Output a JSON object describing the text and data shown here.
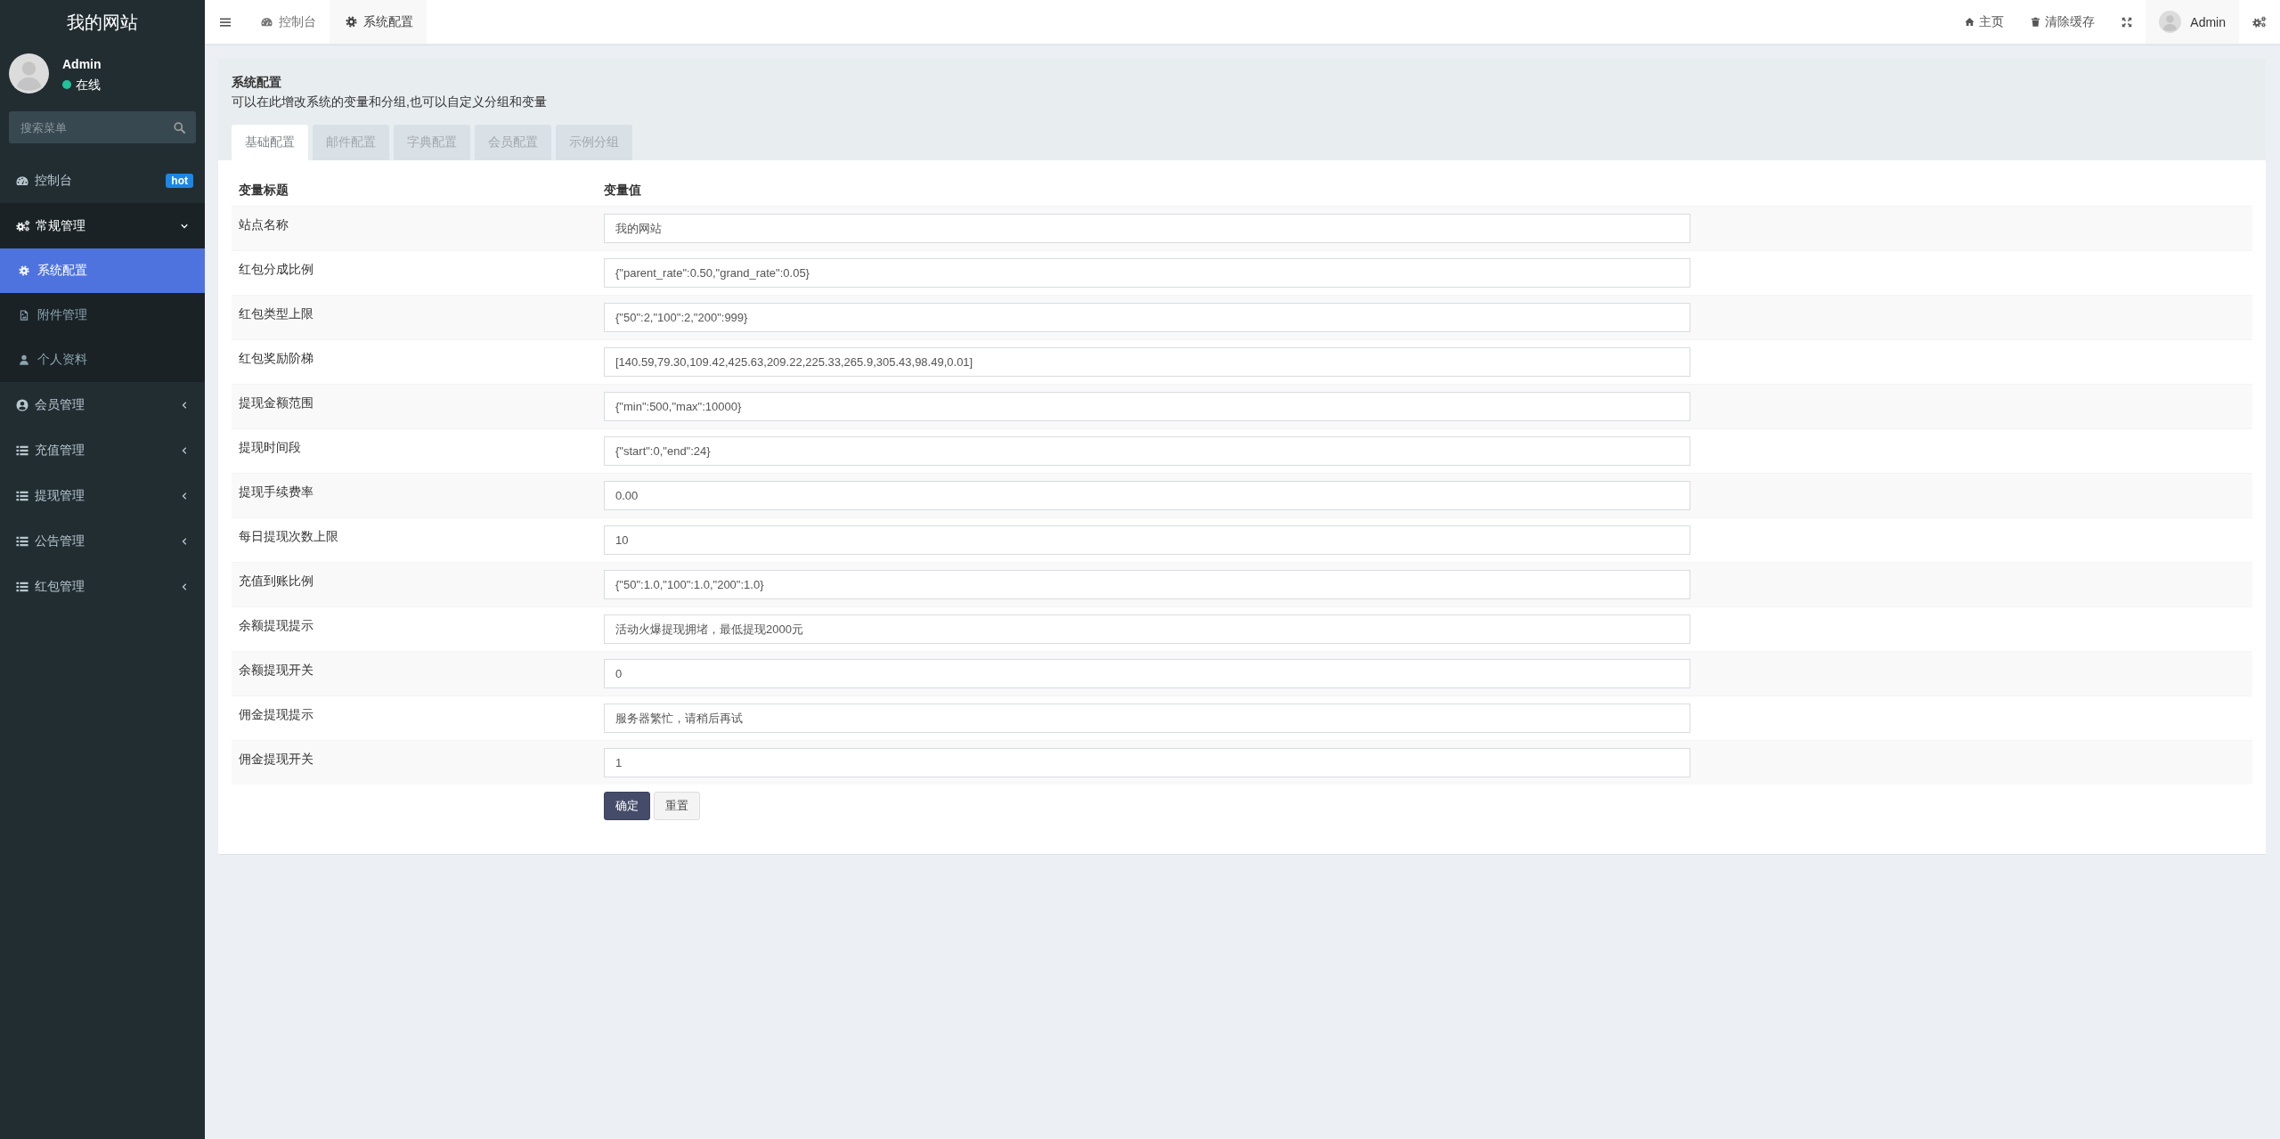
{
  "sidebar": {
    "logo": "我的网站",
    "user": {
      "name": "Admin",
      "status": "在线",
      "online": true
    },
    "search": {
      "placeholder": "搜索菜单"
    },
    "menu": [
      {
        "label": "控制台",
        "badge": "hot",
        "selected": false
      },
      {
        "label": "常规管理",
        "selected": false,
        "expanded": true,
        "children": [
          {
            "label": "系统配置",
            "selected": true
          },
          {
            "label": "附件管理",
            "selected": false
          },
          {
            "label": "个人资料",
            "selected": false
          }
        ]
      },
      {
        "label": "会员管理",
        "selected": false,
        "expanded": false
      },
      {
        "label": "充值管理",
        "selected": false,
        "expanded": false
      },
      {
        "label": "提现管理",
        "selected": false,
        "expanded": false
      },
      {
        "label": "公告管理",
        "selected": false,
        "expanded": false
      },
      {
        "label": "红包管理",
        "selected": false,
        "expanded": false
      }
    ]
  },
  "topbar": {
    "tabs": [
      {
        "label": "控制台",
        "selected": false
      },
      {
        "label": "系统配置",
        "selected": true
      }
    ],
    "links": [
      {
        "label": "主页"
      },
      {
        "label": "清除缓存"
      }
    ],
    "user": {
      "name": "Admin"
    }
  },
  "panel": {
    "title": "系统配置",
    "description": "可以在此增改系统的变量和分组,也可以自定义分组和变量",
    "tabs": [
      {
        "label": "基础配置",
        "selected": true
      },
      {
        "label": "邮件配置",
        "selected": false
      },
      {
        "label": "字典配置",
        "selected": false
      },
      {
        "label": "会员配置",
        "selected": false
      },
      {
        "label": "示例分组",
        "selected": false
      }
    ],
    "table": {
      "columns": [
        "变量标题",
        "变量值"
      ],
      "rows": [
        {
          "label": "站点名称",
          "value": "我的网站"
        },
        {
          "label": "红包分成比例",
          "value": "{\"parent_rate\":0.50,\"grand_rate\":0.05}"
        },
        {
          "label": "红包类型上限",
          "value": "{\"50\":2,\"100\":2,\"200\":999}"
        },
        {
          "label": "红包奖励阶梯",
          "value": "[140.59,79.30,109.42,425.63,209.22,225.33,265.9,305.43,98.49,0.01]"
        },
        {
          "label": "提现金额范围",
          "value": "{\"min\":500,\"max\":10000}"
        },
        {
          "label": "提现时间段",
          "value": "{\"start\":0,\"end\":24}"
        },
        {
          "label": "提现手续费率",
          "value": "0.00"
        },
        {
          "label": "每日提现次数上限",
          "value": "10"
        },
        {
          "label": "充值到账比例",
          "value": "{\"50\":1.0,\"100\":1.0,\"200\":1.0}"
        },
        {
          "label": "余额提现提示",
          "value": "活动火爆提现拥堵，最低提现2000元"
        },
        {
          "label": "余额提现开关",
          "value": "0"
        },
        {
          "label": "佣金提现提示",
          "value": "服务器繁忙，请稍后再试"
        },
        {
          "label": "佣金提现开关",
          "value": "1"
        }
      ]
    },
    "buttons": [
      {
        "label": "确定",
        "kind": "primary"
      },
      {
        "label": "重置",
        "kind": "default"
      }
    ]
  }
}
